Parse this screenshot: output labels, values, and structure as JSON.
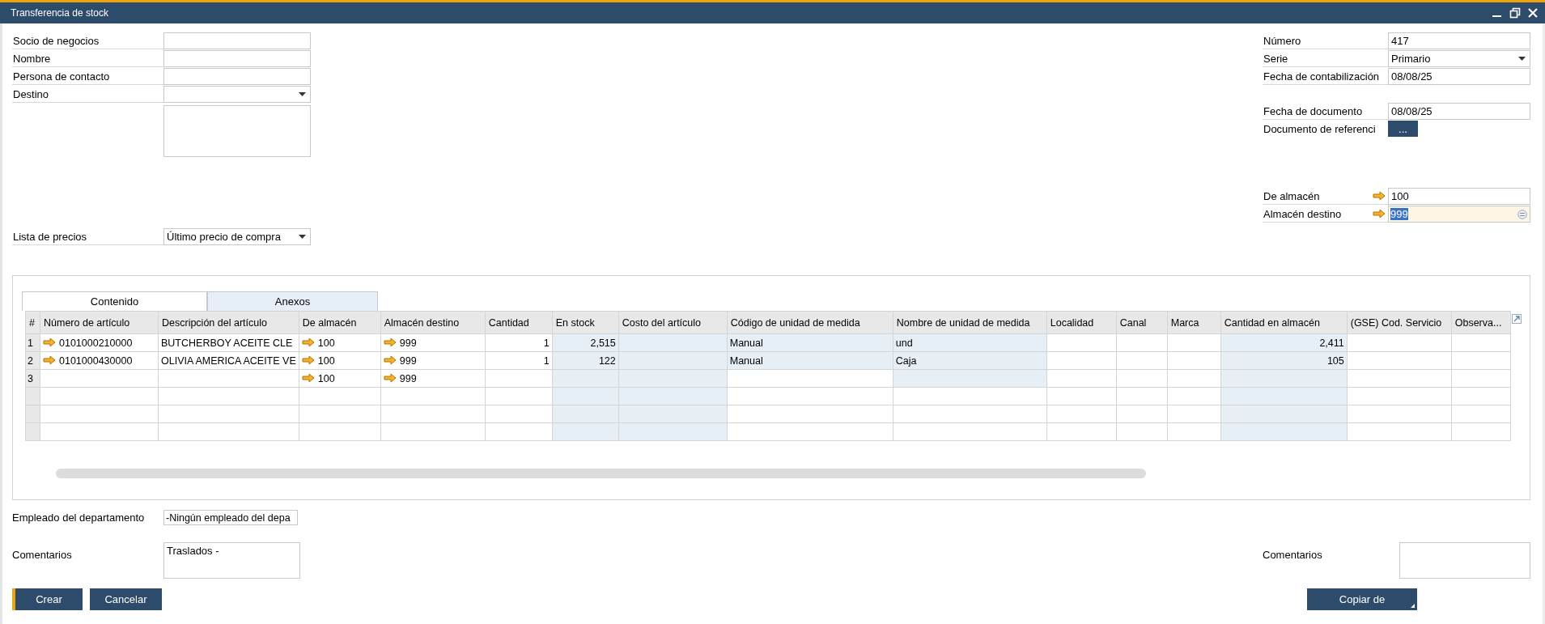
{
  "window": {
    "title": "Transferencia de stock"
  },
  "header_left": [
    [
      {
        "label": "Socio de negocios",
        "kind": "text"
      },
      {
        "label": "Nombre",
        "kind": "text"
      },
      {
        "label": "Persona de contacto",
        "kind": "text"
      },
      {
        "label": "Destino",
        "kind": "dropdown"
      },
      {
        "kind": "textarea"
      }
    ],
    [
      {
        "label": "Lista de precios",
        "kind": "dropdown",
        "value": "Último precio de compra"
      }
    ]
  ],
  "header_right": [
    [
      {
        "label": "Número",
        "kind": "text",
        "value": "417"
      },
      {
        "label": "Serie",
        "kind": "dropdown",
        "value": "Primario"
      },
      {
        "label": "Fecha de contabilización",
        "kind": "text",
        "value": "08/08/25"
      }
    ],
    [
      {
        "label": "Fecha de documento",
        "kind": "text",
        "value": "08/08/25"
      },
      {
        "label": "Documento de referenci",
        "kind": "button",
        "value": "..."
      }
    ],
    [
      {
        "label": "De almacén",
        "kind": "text",
        "value": "100",
        "link": true,
        "focused": false
      },
      {
        "label": "Almacén destino",
        "kind": "text",
        "value": "999",
        "link": true,
        "focused": true
      }
    ]
  ],
  "tabs": [
    {
      "label": "Contenido",
      "selected": true
    },
    {
      "label": "Anexos",
      "selected": false
    }
  ],
  "table": {
    "columns": [
      {
        "label": "#",
        "kind": "index"
      },
      {
        "label": "Número de artículo",
        "kind": "link"
      },
      {
        "label": "Descripción del artículo",
        "kind": "text"
      },
      {
        "label": "De almacén",
        "kind": "link"
      },
      {
        "label": "Almacén destino",
        "kind": "link"
      },
      {
        "label": "Cantidad",
        "kind": "number"
      },
      {
        "label": "En stock",
        "kind": "number"
      },
      {
        "label": "Costo del artículo",
        "kind": "text"
      },
      {
        "label": "Código de unidad de medida",
        "kind": "text"
      },
      {
        "label": "Nombre de unidad de medida",
        "kind": "text"
      },
      {
        "label": "Localidad",
        "kind": "text"
      },
      {
        "label": "Canal",
        "kind": "text"
      },
      {
        "label": "Marca",
        "kind": "text"
      },
      {
        "label": "Cantidad en almacén",
        "kind": "number"
      },
      {
        "label": "(GSE) Cod. Servicio",
        "kind": "text"
      },
      {
        "label": "Observa...",
        "kind": "text"
      }
    ],
    "rows": [
      {
        "cells": [
          "1",
          "0101000210000",
          "BUTCHERBOY ACEITE CLE",
          "100",
          "999",
          "1",
          "2,515",
          null,
          "Manual",
          "und",
          null,
          null,
          null,
          "2,411",
          null,
          null
        ],
        "shaded": [
          false,
          false,
          false,
          false,
          false,
          false,
          true,
          true,
          true,
          true,
          false,
          false,
          false,
          true,
          false,
          false
        ]
      },
      {
        "cells": [
          "2",
          "0101000430000",
          "OLIVIA AMERICA ACEITE VE",
          "100",
          "999",
          "1",
          "122",
          null,
          "Manual",
          "Caja",
          null,
          null,
          null,
          "105",
          null,
          null
        ],
        "shaded": [
          false,
          false,
          false,
          false,
          false,
          false,
          true,
          true,
          true,
          true,
          false,
          false,
          false,
          true,
          false,
          false
        ]
      },
      {
        "cells": [
          "3",
          null,
          null,
          "100",
          "999"
        ],
        "shaded": [
          false,
          false,
          false,
          false,
          false,
          false,
          true,
          true,
          false,
          true,
          false,
          false,
          false,
          true,
          false,
          false
        ]
      },
      {
        "cells": [],
        "shaded": [
          false,
          false,
          false,
          false,
          false,
          false,
          true,
          true,
          false,
          false,
          false,
          false,
          false,
          true,
          false,
          false
        ]
      },
      {
        "cells": [],
        "shaded": [
          false,
          false,
          false,
          false,
          false,
          false,
          true,
          true,
          false,
          false,
          false,
          false,
          false,
          true,
          false,
          false
        ]
      },
      {
        "cells": [],
        "shaded": [
          false,
          false,
          false,
          false,
          false,
          false,
          true,
          true,
          false,
          false,
          false,
          false,
          false,
          true,
          false,
          false
        ]
      }
    ]
  },
  "footer": {
    "employee": {
      "label": "Empleado del departamento",
      "value": "-Ningún empleado del depa"
    },
    "comments_left": {
      "label": "Comentarios",
      "value": "Traslados -"
    },
    "comments_right": {
      "label": "Comentarios"
    },
    "buttons_left": [
      {
        "label": "Crear",
        "kind": "primary"
      },
      {
        "label": "Cancelar",
        "kind": "normal"
      }
    ],
    "buttons_right": [
      {
        "label": "Copiar de",
        "kind": "menu"
      }
    ]
  }
}
